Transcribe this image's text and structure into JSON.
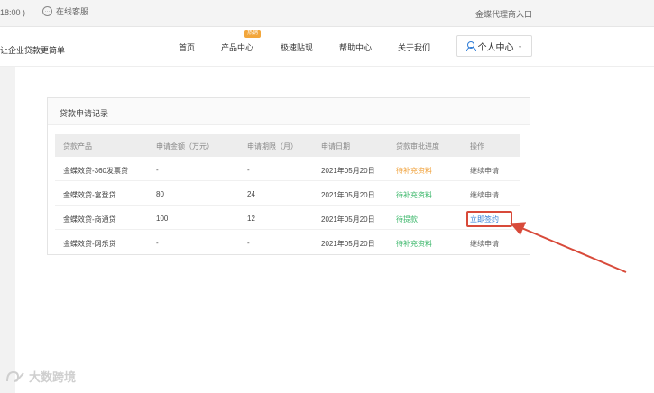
{
  "topbar": {
    "hours": "18:00 )",
    "service_label": "在线客服",
    "service_icon": "chat-bubble-icon",
    "agent_entry": "金蝶代理商入口"
  },
  "navbar": {
    "slogan": "让企业贷款更简单",
    "items": [
      {
        "label": "首页"
      },
      {
        "label": "产品中心",
        "badge": "热销"
      },
      {
        "label": "极速贴现"
      },
      {
        "label": "帮助中心"
      },
      {
        "label": "关于我们"
      }
    ],
    "user_menu": "个人中心",
    "user_icon": "user-icon",
    "chevron_icon": "chevron-down-icon"
  },
  "panel": {
    "title": "贷款申请记录",
    "columns": [
      "贷款产品",
      "申请金额（万元）",
      "申请期限（月）",
      "申请日期",
      "贷款审批进度",
      "操作"
    ],
    "rows": [
      {
        "product": "金蝶效贷-360发票贷",
        "amount": "-",
        "term": "-",
        "date": "2021年05月20日",
        "status": "待补充资料",
        "status_color": "#f0a23c",
        "action": "继续申请"
      },
      {
        "product": "金蝶效贷-富登贷",
        "amount": "80",
        "term": "24",
        "date": "2021年05月20日",
        "status": "待补充资料",
        "status_color": "#3bb76a",
        "action": "继续申请"
      },
      {
        "product": "金蝶效贷-商通贷",
        "amount": "100",
        "term": "12",
        "date": "2021年05月20日",
        "status": "待提款",
        "status_color": "#3bb76a",
        "action": "立即签约",
        "highlighted": true
      },
      {
        "product": "金蝶效贷-网乐贷",
        "amount": "-",
        "term": "-",
        "date": "2021年05月20日",
        "status": "待补充资料",
        "status_color": "#3bb76a",
        "action": "继续申请"
      }
    ]
  },
  "annotation": {
    "box_color": "#d84a3a",
    "arrow_color": "#d84a3a"
  },
  "watermark": {
    "text": "大数跨境"
  }
}
